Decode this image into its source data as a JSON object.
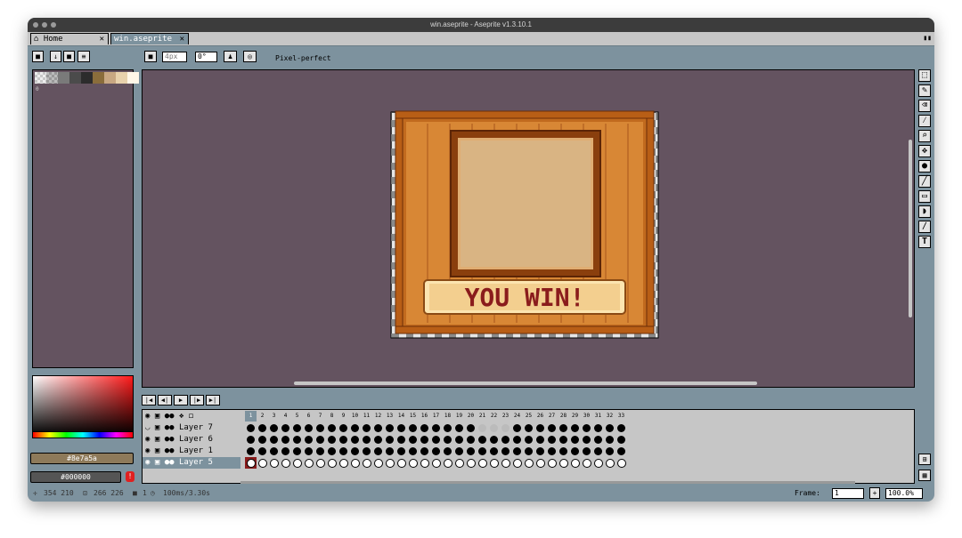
{
  "window": {
    "title": "win.aseprite - Aseprite v1.3.10.1"
  },
  "tabs": [
    {
      "label": "Home",
      "icon": "home-icon",
      "close": "✕"
    },
    {
      "label": "win.aseprite",
      "close": "✕"
    }
  ],
  "topbar": {
    "brush_size": "4px",
    "angle": "0°",
    "pixel_perfect_label": "Pixel-perfect"
  },
  "palette": {
    "index_label": "0",
    "swatches": [
      "#d0d0d0",
      "#a8a8a8",
      "#7a7a7a",
      "#4b4b4b",
      "#2c2c2c",
      "#8a6d3b",
      "#c8a882",
      "#e8d2ac",
      "#fff7e8"
    ]
  },
  "colors": {
    "foreground_hex": "#8e7a5a",
    "background_hex": "#000000"
  },
  "artwork": {
    "banner_text": "YOU WIN!"
  },
  "timeline": {
    "layers": [
      "Layer 7",
      "Layer 6",
      "Layer 1",
      "Layer 5"
    ],
    "frames": [
      "1",
      "2",
      "3",
      "4",
      "5",
      "6",
      "7",
      "8",
      "9",
      "10",
      "11",
      "12",
      "13",
      "14",
      "15",
      "16",
      "17",
      "18",
      "19",
      "20",
      "21",
      "22",
      "23",
      "24",
      "25",
      "26",
      "27",
      "28",
      "29",
      "30",
      "31",
      "32",
      "33"
    ]
  },
  "status": {
    "position": "354 210",
    "size": "266 226",
    "frame_index": "1",
    "duration": "100ms/3.30s",
    "frame_label": "Frame:",
    "frame_value": "1",
    "zoom": "100.0%"
  },
  "accent": {
    "canvas_bg": "#645360",
    "ui_bg": "#7d929e"
  }
}
